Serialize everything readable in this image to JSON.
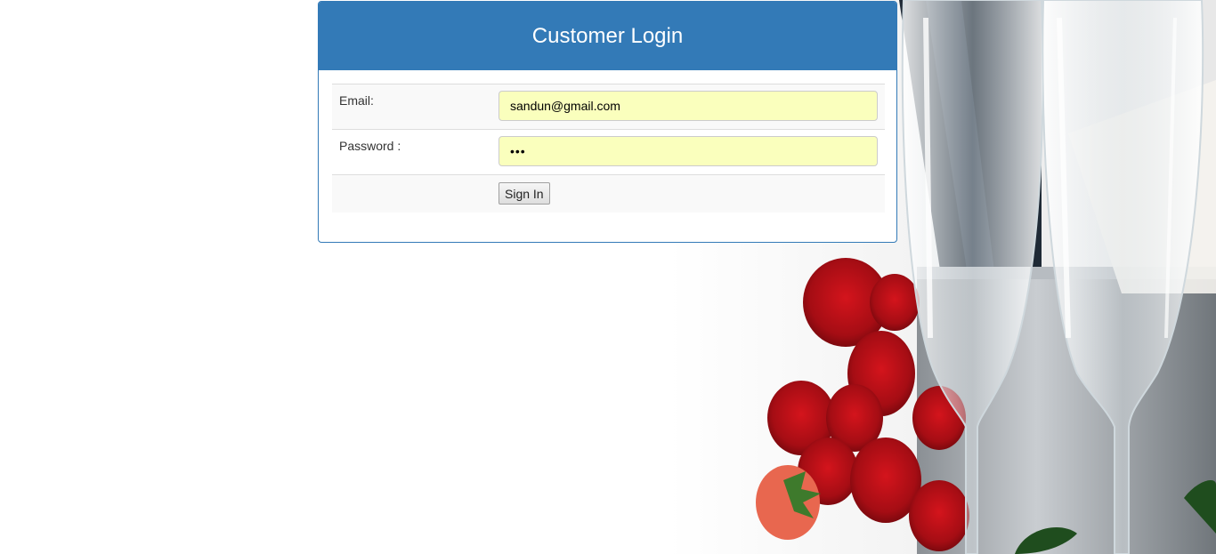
{
  "page": {
    "background_color": "#ffffff",
    "accent_color": "#337ab7",
    "autofill_color": "#faffbd"
  },
  "login": {
    "title": "Customer Login",
    "email_label": "Email:",
    "email_value": "sandun@gmail.com",
    "password_label": "Password :",
    "password_value": "•••",
    "signin_label": "Sign In"
  },
  "background_image": {
    "icon": "champagne-glasses-roses-photo"
  }
}
